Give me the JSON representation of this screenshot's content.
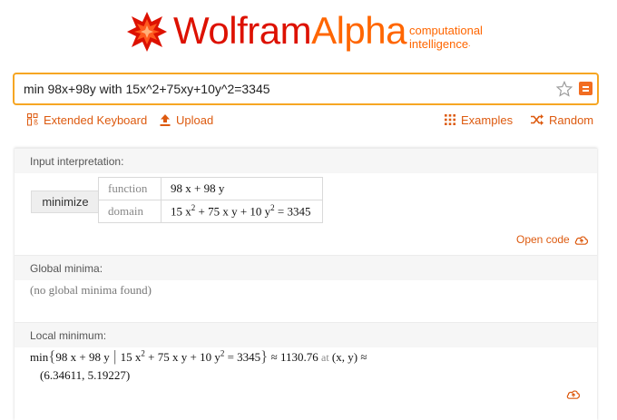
{
  "logo": {
    "word_part1": "Wolfram",
    "word_part2": "Alpha",
    "tagline_line1": "computational",
    "tagline_line2": "intelligence",
    "trademark": ".",
    "brand_red": "#dd1100",
    "brand_orange": "#ff6600"
  },
  "search": {
    "query": "min 98x+98y with 15x^2+75xy+10y^2=3345",
    "favorite_icon": "star-icon",
    "submit_icon": "equals-icon",
    "accent": "#f6a623"
  },
  "toolbar": {
    "extended_keyboard": "Extended Keyboard",
    "upload": "Upload",
    "examples": "Examples",
    "random": "Random",
    "link_color": "#dd5a0f"
  },
  "pods": {
    "input_interpretation": {
      "title": "Input interpretation:",
      "action": "minimize",
      "function_label": "function",
      "function_value": "98 x + 98 y",
      "domain_label": "domain",
      "domain_parts": [
        "15 x",
        "2",
        " + 75 x y + 10 y",
        "2",
        " = 3345"
      ],
      "open_code": "Open code"
    },
    "global_minima": {
      "title": "Global minima:",
      "text": "(no global minima found)"
    },
    "local_minimum": {
      "title": "Local minimum:",
      "min": "min",
      "expr": "98 x + 98 y",
      "cond_parts": [
        "15 x",
        "2",
        " + 75 x y + 10 y",
        "2",
        " = 3345"
      ],
      "approx_value": "≈ 1130.76",
      "at": "at",
      "point_label": "(x, y) ≈",
      "point_value": "(6.34611, 5.19227)"
    }
  }
}
